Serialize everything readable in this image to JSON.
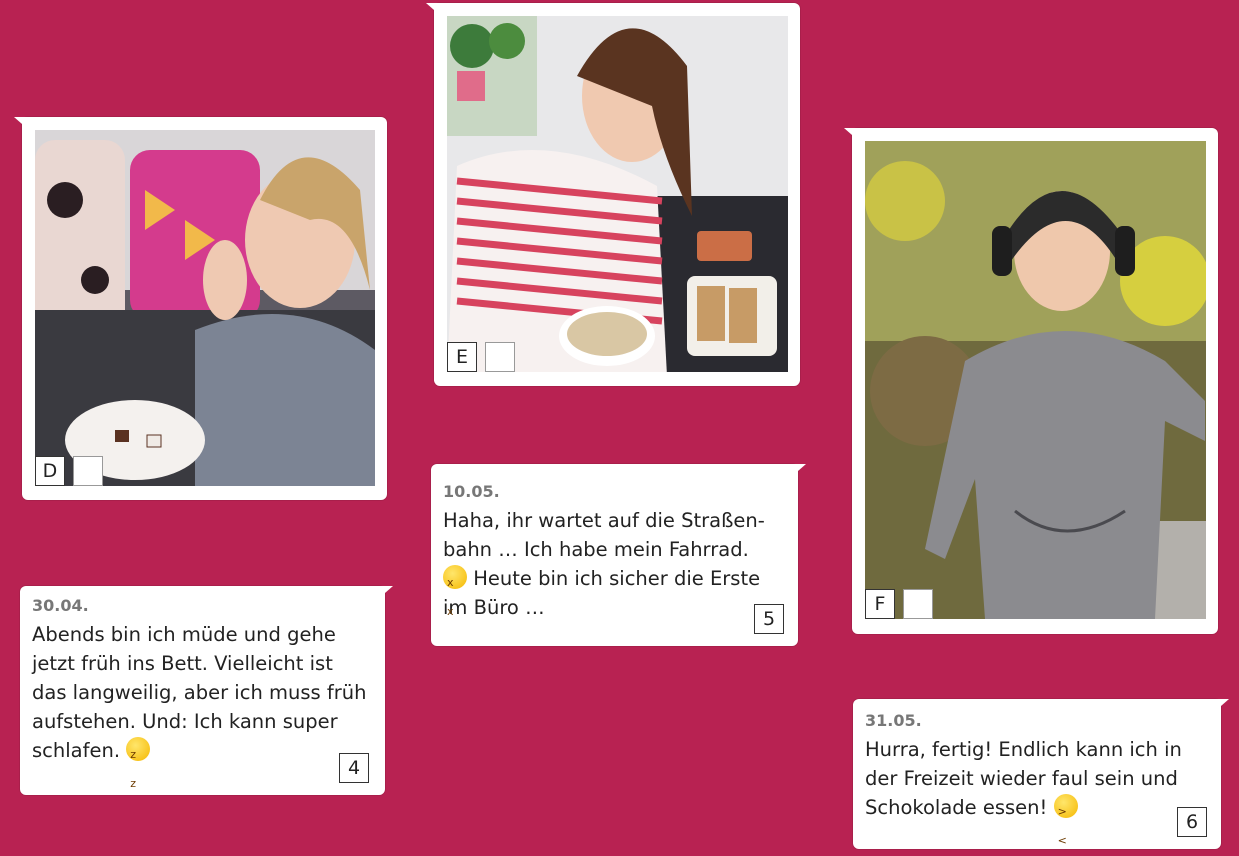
{
  "photos": [
    {
      "id": "D",
      "label": "D",
      "answer": ""
    },
    {
      "id": "E",
      "label": "E",
      "answer": ""
    },
    {
      "id": "F",
      "label": "F",
      "answer": ""
    }
  ],
  "posts": [
    {
      "date": "30.04.",
      "lines": [
        "Abends bin ich müde und gehe",
        "jetzt früh ins Bett. Vielleicht ist",
        "das langweilig, aber ich muss früh",
        "aufstehen. Und: Ich kann super",
        "schlafen."
      ],
      "number": "4"
    },
    {
      "date": "10.05.",
      "lines": [
        "Haha, ihr wartet auf die Straßen-",
        "bahn … Ich habe mein Fahrrad.",
        "Heute bin ich sicher die Erste",
        "im Büro …"
      ],
      "number": "5"
    },
    {
      "date": "31.05.",
      "lines": [
        "Hurra, fertig! Endlich kann ich in",
        "der Freizeit wieder faul sein und",
        "Schokolade essen!"
      ],
      "number": "6"
    }
  ],
  "colors": {
    "background": "#b82252",
    "card": "#ffffff"
  },
  "icons": [
    "sleeping-face-emoji",
    "tongue-wink-emoji",
    "laughing-face-emoji"
  ]
}
